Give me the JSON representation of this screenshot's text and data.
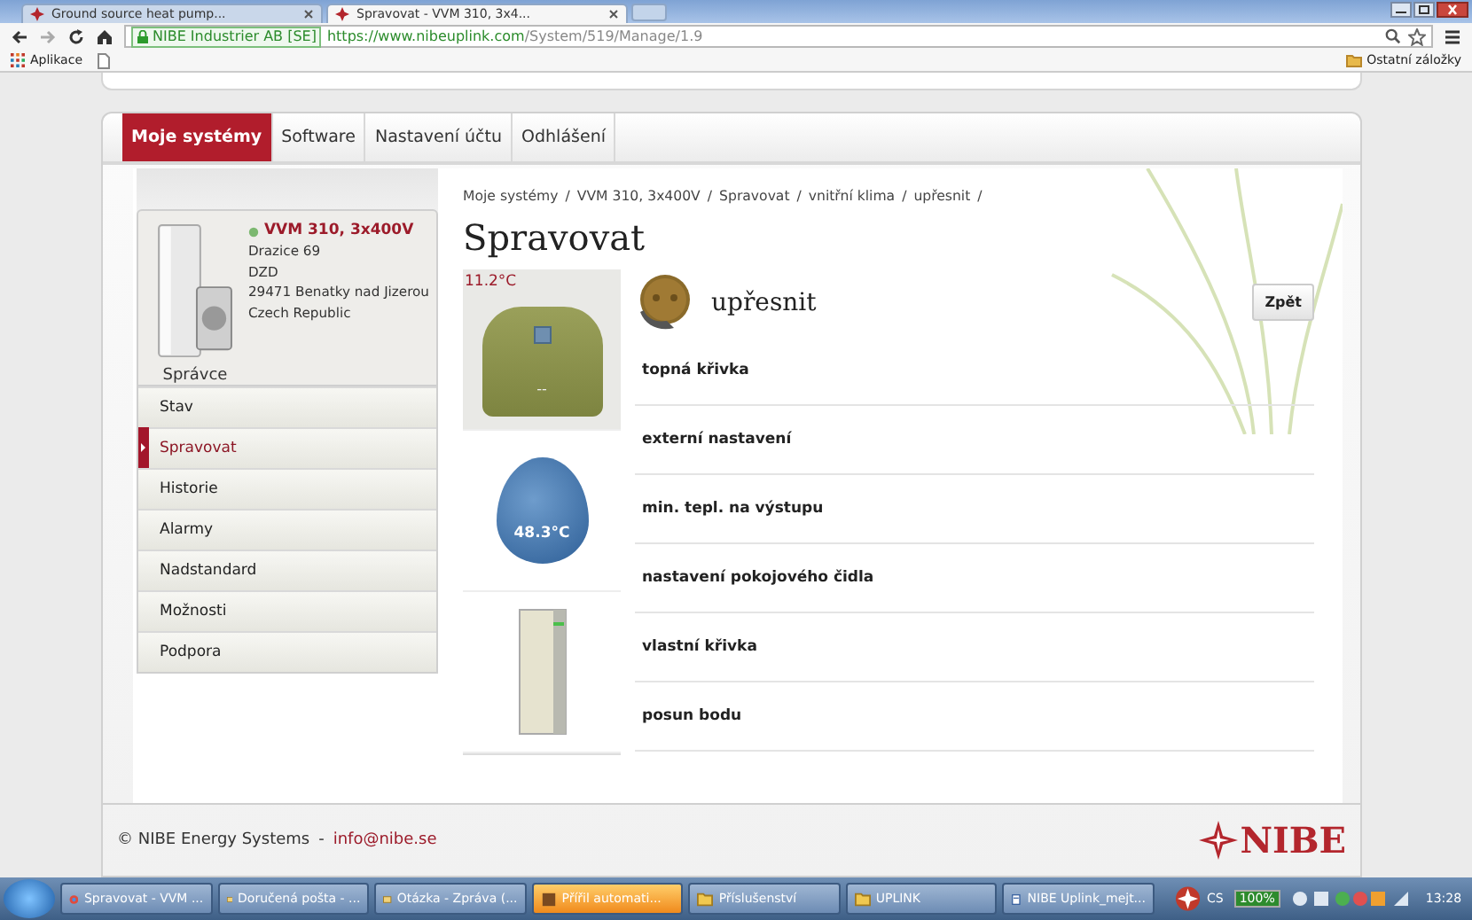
{
  "browser": {
    "tabs": [
      {
        "title": "Ground source heat pump...",
        "selected": false
      },
      {
        "title": "Spravovat - VVM 310, 3x4...",
        "selected": true
      }
    ],
    "site_identity": "NIBE Industrier AB [SE]",
    "url_host": "https://www.nibeuplink.com",
    "url_path": "/System/519/Manage/1.9",
    "bookmarks": [
      "Aplikace"
    ],
    "other_bookmarks": "Ostatní záložky"
  },
  "nav": [
    {
      "label": "Moje systémy",
      "selected": true
    },
    {
      "label": "Software",
      "selected": false
    },
    {
      "label": "Nastavení účtu",
      "selected": false
    },
    {
      "label": "Odhlášení",
      "selected": false
    }
  ],
  "system": {
    "name": "VVM 310, 3x400V",
    "online": true,
    "address": [
      "Drazice 69",
      "DZD",
      "29471 Benatky nad Jizerou",
      "Czech Republic"
    ],
    "role": "Správce"
  },
  "sidebar": {
    "items": [
      {
        "label": "Stav",
        "selected": false
      },
      {
        "label": "Spravovat",
        "selected": true
      },
      {
        "label": "Historie",
        "selected": false
      },
      {
        "label": "Alarmy",
        "selected": false
      },
      {
        "label": "Nadstandard",
        "selected": false
      },
      {
        "label": "Možnosti",
        "selected": false
      },
      {
        "label": "Podpora",
        "selected": false
      }
    ]
  },
  "breadcrumb_separator": "/",
  "breadcrumb": [
    "Moje systémy",
    "VVM 310, 3x400V",
    "Spravovat",
    "vnitřní klima",
    "upřesnit"
  ],
  "title": "Spravovat",
  "tiles": [
    {
      "kind": "house",
      "selected": true,
      "reading": "11.2°C",
      "value": "--"
    },
    {
      "kind": "drop",
      "selected": false,
      "reading": "48.3°C"
    },
    {
      "kind": "unit",
      "selected": false
    }
  ],
  "section": {
    "title": "upřesnit",
    "back_button": "Zpět",
    "items": [
      "topná křivka",
      "externí nastavení",
      "min. tepl. na výstupu",
      "nastavení pokojového čidla",
      "vlastní křivka",
      "posun bodu"
    ]
  },
  "footer": {
    "copyright": "© NIBE Energy Systems",
    "separator": "-",
    "email": "info@nibe.se",
    "logo": "NIBE"
  },
  "taskbar": {
    "items": [
      {
        "label": "Spravovat - VVM ...",
        "kind": "browser",
        "flashing": false
      },
      {
        "label": "Doručená pošta - ...",
        "kind": "mail",
        "flashing": false
      },
      {
        "label": "Otázka - Zpráva (...",
        "kind": "mail",
        "flashing": false
      },
      {
        "label": "Přířil automati...",
        "kind": "app",
        "flashing": true
      },
      {
        "label": "Příslušenství",
        "kind": "folder",
        "flashing": false
      },
      {
        "label": "UPLINK",
        "kind": "folder",
        "flashing": false
      },
      {
        "label": "NIBE Uplink_mejt...",
        "kind": "doc",
        "flashing": false
      }
    ],
    "language": "CS",
    "battery": "100%",
    "time": "13:28"
  }
}
